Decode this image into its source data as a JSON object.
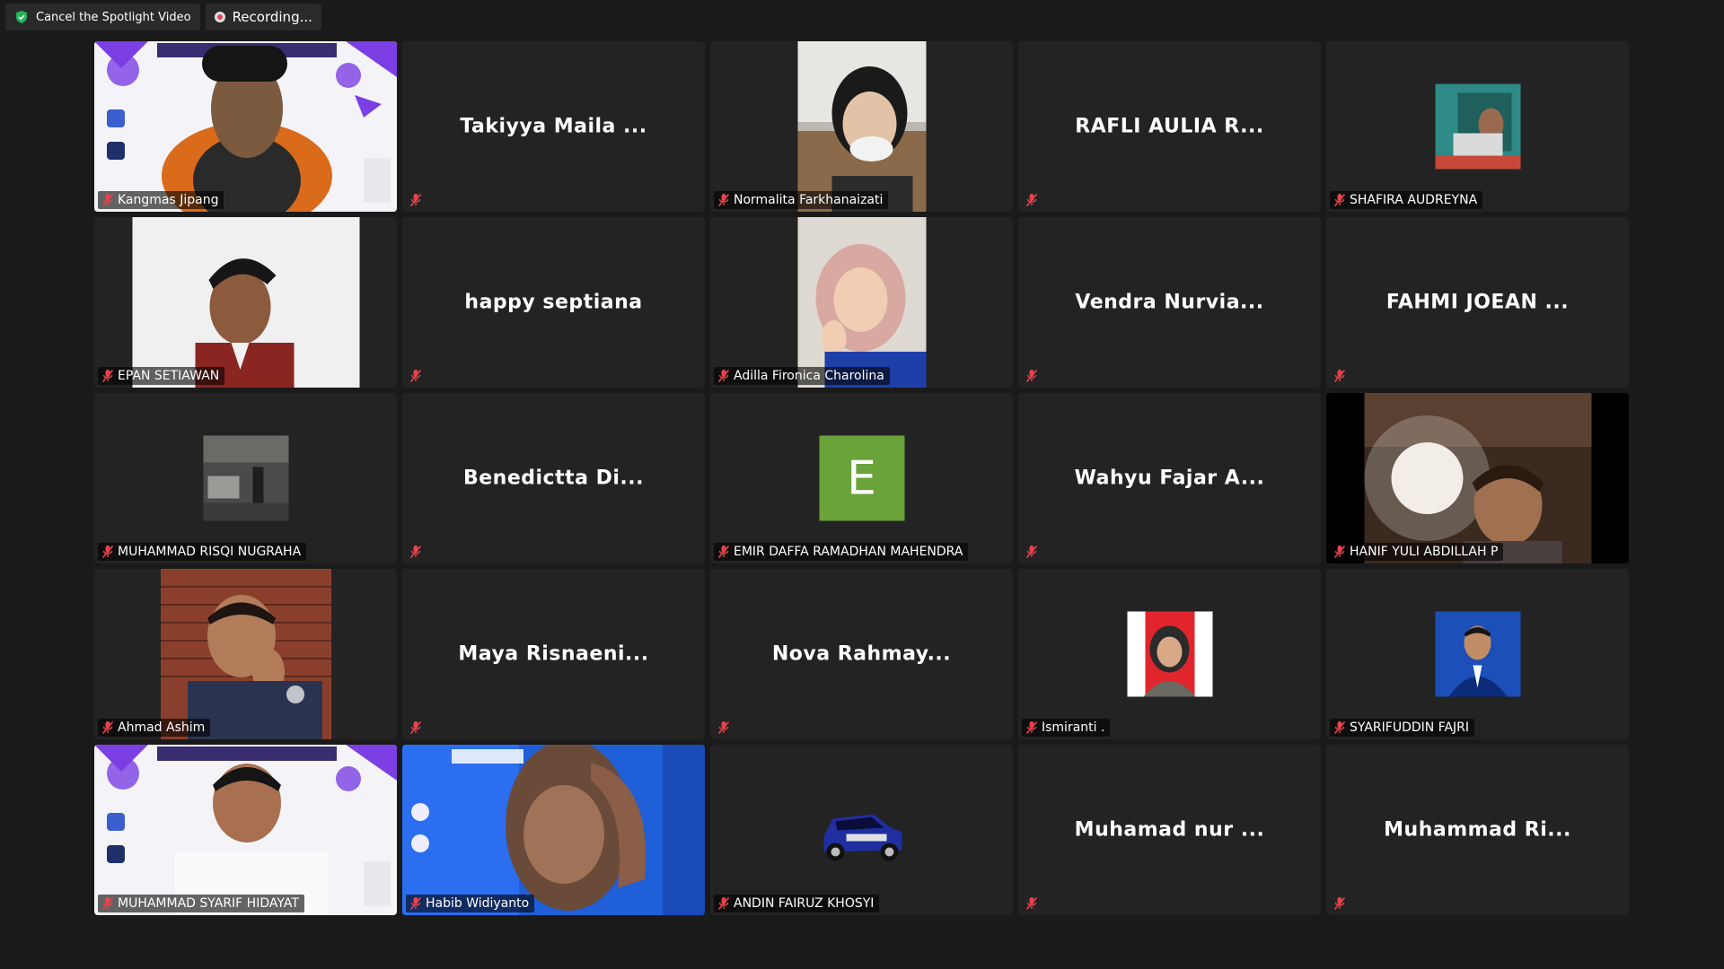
{
  "toolbar": {
    "spotlight_label": "Cancel the Spotlight Video",
    "recording_label": "Recording..."
  },
  "colors": {
    "background": "#1a1a1a",
    "tile": "#232323",
    "mute_red": "#e8424a",
    "avatar_green": "#6aa33a"
  },
  "participants": [
    {
      "name": "Kangmas Jipang",
      "display": "",
      "video": "workshop-banner-person"
    },
    {
      "name": "",
      "display": "Takiyya Maila ...",
      "video": "none"
    },
    {
      "name": "Normalita Farkhanaizati",
      "display": "",
      "video": "person-mask"
    },
    {
      "name": "",
      "display": "RAFLI AULIA R...",
      "video": "none"
    },
    {
      "name": "SHAFIRA AUDREYNA",
      "display": "",
      "video": "thumbnail"
    },
    {
      "name": "EPAN SETIAWAN",
      "display": "",
      "video": "person-red-shirt"
    },
    {
      "name": "",
      "display": "happy septiana",
      "video": "none"
    },
    {
      "name": "Adilla Fironica Charolina",
      "display": "",
      "video": "person-hijab"
    },
    {
      "name": "",
      "display": "Vendra Nurvia...",
      "video": "none"
    },
    {
      "name": "",
      "display": "FAHMI JOEAN ...",
      "video": "none"
    },
    {
      "name": "MUHAMMAD RISQI NUGRAHA",
      "display": "",
      "video": "thumbnail-garage"
    },
    {
      "name": "",
      "display": "Benedictta Di...",
      "video": "none"
    },
    {
      "name": "EMIR DAFFA RAMADHAN MAHENDRA",
      "display": "",
      "video": "avatar-letter",
      "avatar_letter": "E"
    },
    {
      "name": "",
      "display": "Wahyu Fajar A...",
      "video": "none"
    },
    {
      "name": "HANIF YULI ABDILLAH P",
      "display": "",
      "video": "person-dark-room"
    },
    {
      "name": "Ahmad Ashim",
      "display": "",
      "video": "person-brick-wall"
    },
    {
      "name": "",
      "display": "Maya Risnaeni...",
      "video": "none"
    },
    {
      "name": "",
      "display": "Nova Rahmay...",
      "video": "none"
    },
    {
      "name": "Ismiranti .",
      "display": "",
      "video": "thumbnail-portrait-red"
    },
    {
      "name": "SYARIFUDDIN FAJRI",
      "display": "",
      "video": "thumbnail-portrait-blue"
    },
    {
      "name": "MUHAMMAD SYARIF HIDAYAT",
      "display": "",
      "video": "workshop-banner-person2"
    },
    {
      "name": "Habib Widiyanto",
      "display": "",
      "video": "person-blue-banner"
    },
    {
      "name": "ANDIN FAIRUZ KHOSYI",
      "display": "",
      "video": "thumbnail-car"
    },
    {
      "name": "",
      "display": "Muhamad nur ...",
      "video": "none"
    },
    {
      "name": "",
      "display": "Muhammad Ri...",
      "video": "none"
    }
  ]
}
